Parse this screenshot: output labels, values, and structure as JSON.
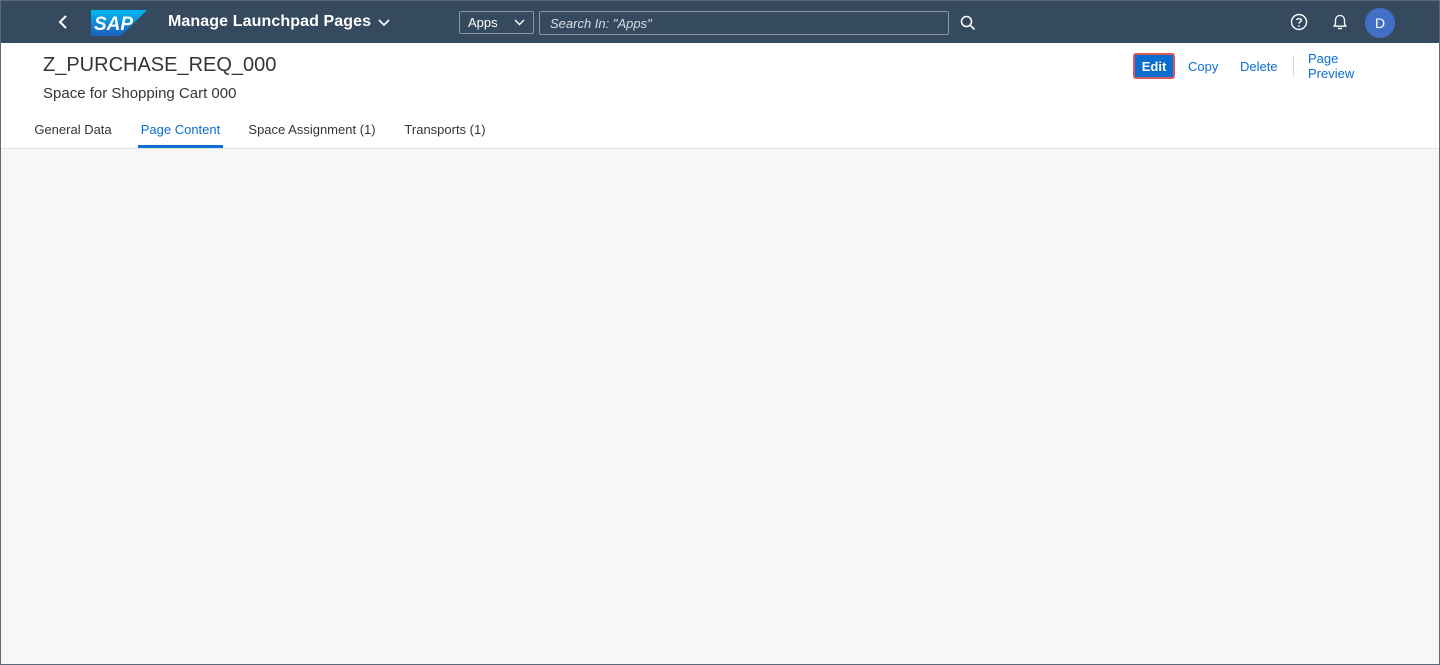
{
  "shell": {
    "logo_text": "SAP",
    "app_title": "Manage Launchpad Pages",
    "search_scope": "Apps",
    "search_placeholder": "Search In: \"Apps\"",
    "avatar_initial": "D",
    "colors": {
      "shell_bg": "#354a5f",
      "logo_blue": "#0a6ed1",
      "avatar_bg": "#4270c6"
    }
  },
  "header": {
    "title": "Z_PURCHASE_REQ_000",
    "subtitle": "Space for Shopping Cart 000"
  },
  "actions": {
    "edit": "Edit",
    "copy": "Copy",
    "delete": "Delete",
    "preview": "Page Preview"
  },
  "tabs": [
    {
      "label": "General Data",
      "selected": false
    },
    {
      "label": "Page Content",
      "selected": true
    },
    {
      "label": "Space Assignment (1)",
      "selected": false
    },
    {
      "label": "Transports (1)",
      "selected": false
    }
  ],
  "icons": {
    "back": "back-icon",
    "app_title_dropdown": "chevron-down-icon",
    "scope_dropdown": "chevron-down-icon",
    "search": "search-icon",
    "help": "help-icon",
    "notifications": "bell-icon"
  },
  "accent_color": "#0a6ed1"
}
